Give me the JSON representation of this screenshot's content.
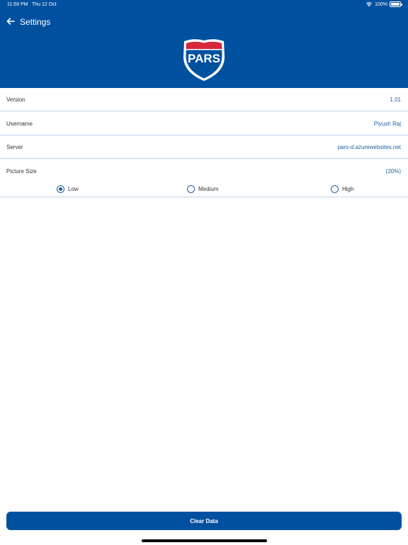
{
  "status_bar": {
    "time": "11:59 PM",
    "date": "Thu 12 Oct",
    "battery": "100%"
  },
  "nav": {
    "title": "Settings"
  },
  "logo": {
    "text": "PARS"
  },
  "settings": {
    "version": {
      "label": "Version",
      "value": "1.01"
    },
    "username": {
      "label": "Username",
      "value": "Piyush Raj"
    },
    "server": {
      "label": "Server",
      "value": "pars-d.azurewebsites.net"
    },
    "picture_size": {
      "label": "Picture Size",
      "value": "(20%)",
      "options": [
        {
          "label": "Low",
          "selected": true
        },
        {
          "label": "Medium",
          "selected": false
        },
        {
          "label": "High",
          "selected": false
        }
      ]
    }
  },
  "actions": {
    "clear_label": "Clear Data"
  },
  "colors": {
    "brand_blue": "#0050a0",
    "accent_text": "#1f5fa0",
    "divider": "#c4d6e8",
    "logo_red": "#d6283c"
  }
}
